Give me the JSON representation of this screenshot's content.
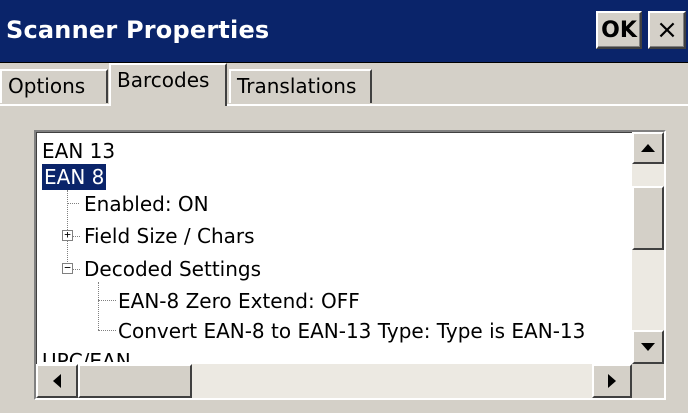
{
  "window": {
    "title": "Scanner Properties",
    "ok_label": "OK",
    "close_label": "×"
  },
  "tabs": [
    {
      "label": "Options",
      "active": false
    },
    {
      "label": "Barcodes",
      "active": true
    },
    {
      "label": "Translations",
      "active": false
    }
  ],
  "tree": {
    "items": [
      {
        "label": "EAN 13",
        "level": 0
      },
      {
        "label": "EAN 8",
        "level": 0,
        "selected": true
      },
      {
        "label": "Enabled: ON",
        "level": 1
      },
      {
        "label": "Field Size / Chars",
        "level": 1,
        "expander": "+"
      },
      {
        "label": "Decoded Settings",
        "level": 1,
        "expander": "−"
      },
      {
        "label": "EAN-8 Zero Extend: OFF",
        "level": 2
      },
      {
        "label": "Convert EAN-8 to EAN-13 Type: Type is EAN-13",
        "level": 2
      },
      {
        "label": "UPC/EAN",
        "level": 0,
        "partially_visible": true
      }
    ]
  },
  "colors": {
    "titlebar": "#0a246a",
    "selection": "#0a246a",
    "face": "#d4d0c8"
  },
  "icons": {
    "up": "up-arrow-icon",
    "down": "down-arrow-icon",
    "left": "left-arrow-icon",
    "right": "right-arrow-icon"
  }
}
